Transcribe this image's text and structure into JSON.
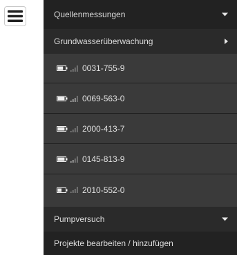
{
  "menu_toggle": {
    "icon": "hamburger-icon"
  },
  "menu": {
    "item_quellenmessungen": {
      "label": "Quellenmessungen",
      "icon": "caret-down-icon"
    },
    "item_grundwasser": {
      "label": "Grundwasserüberwachung",
      "icon": "caret-right-icon"
    },
    "grundwasser_items": [
      {
        "label": "0031-755-9",
        "battery_icon": "battery-icon",
        "signal_icon": "signal-icon",
        "battery_level": 0.7
      },
      {
        "label": "0069-563-0",
        "battery_icon": "battery-icon",
        "signal_icon": "signal-icon",
        "battery_level": 0.9
      },
      {
        "label": "2000-413-7",
        "battery_icon": "battery-icon",
        "signal_icon": "signal-icon",
        "battery_level": 0.9
      },
      {
        "label": "0145-813-9",
        "battery_icon": "battery-icon",
        "signal_icon": "signal-icon",
        "battery_level": 0.9
      },
      {
        "label": "2010-552-0",
        "battery_icon": "battery-icon",
        "signal_icon": "signal-icon",
        "battery_level": 0.5
      }
    ],
    "item_pumpversuch": {
      "label": "Pumpversuch",
      "icon": "caret-down-icon"
    },
    "item_projekte": {
      "label": "Projekte bearbeiten / hinzufügen"
    }
  },
  "colors": {
    "menu_background": "#222222",
    "submenu_background": "#3a3a3a",
    "text": "#dcdcdc"
  }
}
